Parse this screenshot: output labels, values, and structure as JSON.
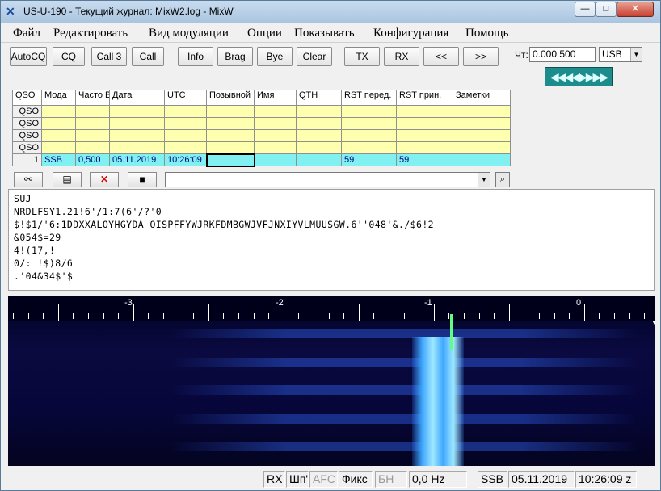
{
  "window": {
    "title": "US-U-190 - Текущий журнал: MixW2.log - MixW"
  },
  "menu": [
    "Файл",
    "Редактировать",
    "Вид модуляции",
    "Опции",
    "Показывать",
    "Конфигурация",
    "Помощь"
  ],
  "toolbar": [
    "AutoCQ",
    "CQ",
    "Call 3",
    "Call",
    "Info",
    "Brag",
    "Bye",
    "Clear",
    "TX",
    "RX",
    "<<",
    ">>"
  ],
  "radio": {
    "freq_label": "Чт:",
    "freq": "0.000.500",
    "mode": "USB",
    "tune_glyph": "◀◀◀◀▶▶▶▶",
    "tune_color": "#1c8c8c"
  },
  "log": {
    "columns": [
      "QSO",
      "Мода",
      "Часто ВЧ",
      "Дата",
      "UTC",
      "Позывной",
      "Имя",
      "QTH",
      "RST перед.",
      "RST прин.",
      "Заметки"
    ],
    "rows": [
      [
        "QSO",
        "",
        "",
        "",
        "",
        "",
        "",
        "",
        "",
        "",
        ""
      ],
      [
        "QSO",
        "",
        "",
        "",
        "",
        "",
        "",
        "",
        "",
        "",
        ""
      ],
      [
        "QSO",
        "",
        "",
        "",
        "",
        "",
        "",
        "",
        "",
        "",
        ""
      ],
      [
        "QSO",
        "",
        "",
        "",
        "",
        "",
        "",
        "",
        "",
        "",
        ""
      ]
    ],
    "current": [
      "1",
      "SSB",
      "0,500",
      "05.11.2019",
      "10:26:09",
      "",
      "",
      "",
      "59",
      "59",
      ""
    ]
  },
  "rx_text": [
    "SUJ",
    "NRDLFSY1.21!6'/1:7(6'/?'0",
    "$!$1/'6:1DDXXALOYHGYDA OISPFFYWJRKFDMBGWJVFJNXIYVLMUUSGW.6''048'&./$6!2",
    "&054$=29",
    "4!(17,!",
    "0/: !$)8/6",
    ".'04&34$'$"
  ],
  "waterfall": {
    "scale_labels": [
      "-3",
      "-2",
      "-1",
      "0"
    ],
    "scale_values": [
      -3,
      -2,
      -1,
      0
    ],
    "signal_color": "#9fe8ff",
    "cursor_color": "#60ff80"
  },
  "status": [
    "RX",
    "Шп'",
    "AFC",
    "Фикс",
    "БН",
    "0,0 Hz",
    "SSB",
    "05.11.2019",
    "10:26:09 z"
  ]
}
